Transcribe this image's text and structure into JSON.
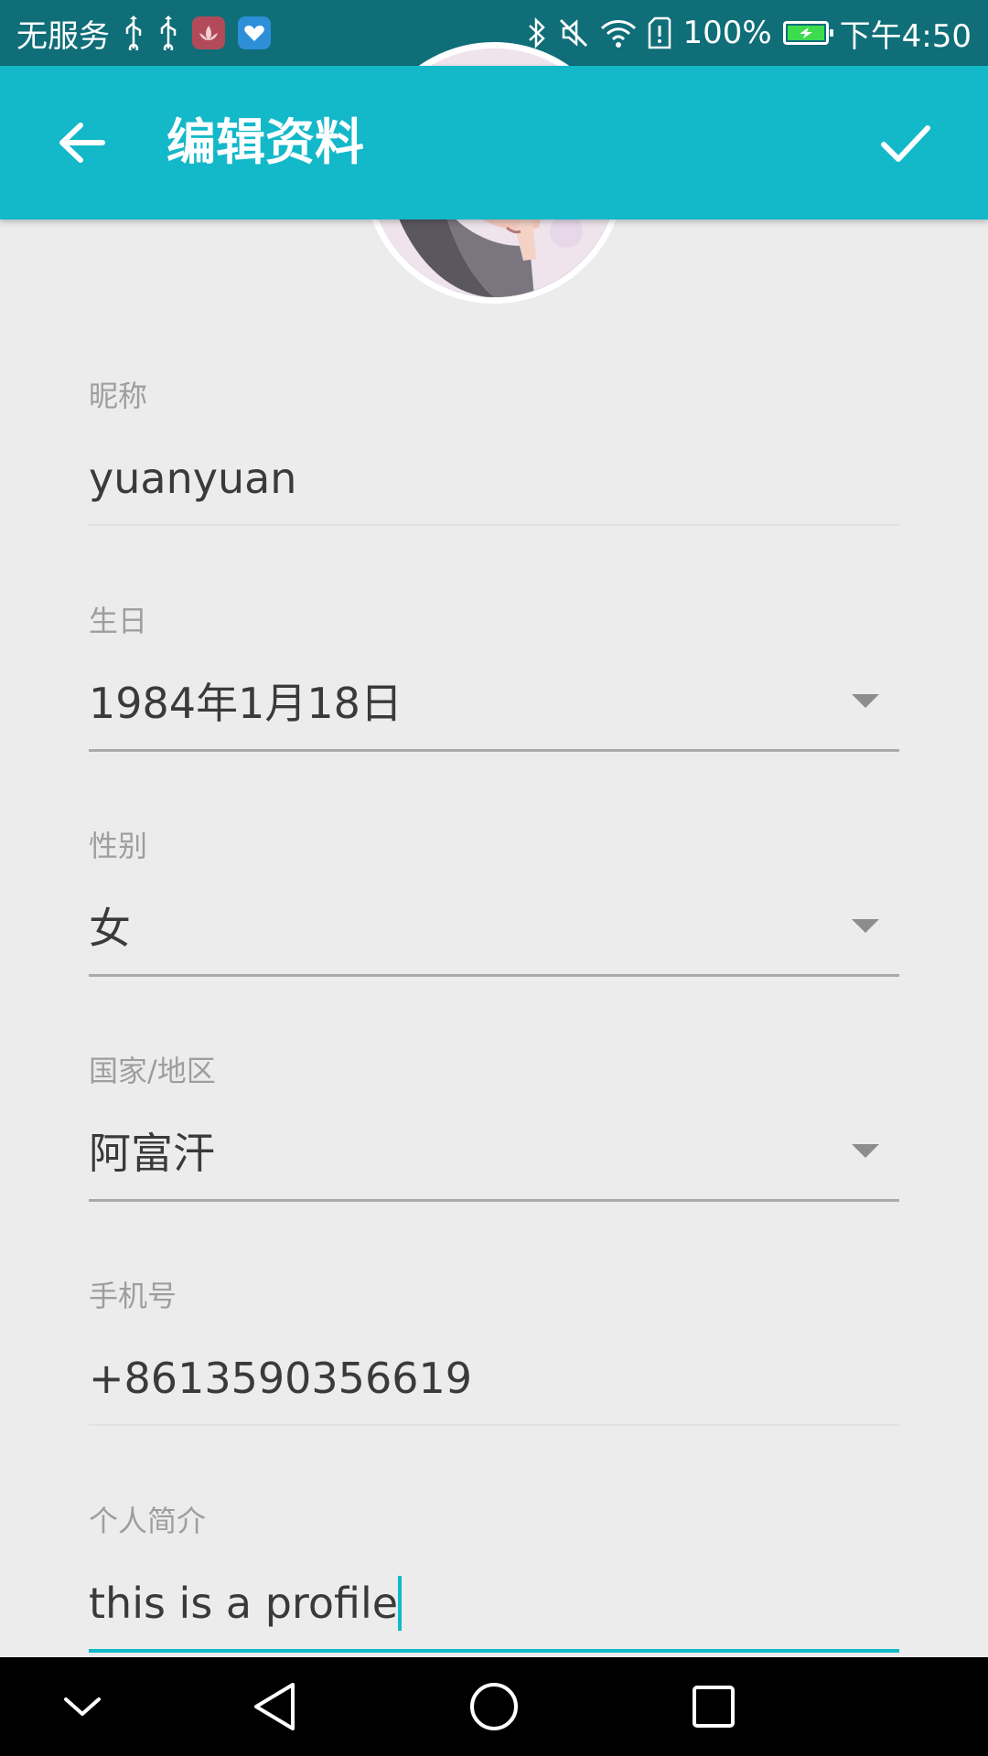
{
  "status_bar": {
    "carrier": "无服务",
    "battery": "100%",
    "time": "下午4:50",
    "battery_level_percent": 100,
    "icons": [
      "usb-icon",
      "usb-icon",
      "lotus-app-icon",
      "heart-app-icon",
      "bluetooth-icon",
      "mute-icon",
      "wifi-icon",
      "sim-alert-icon",
      "battery-charging-icon"
    ]
  },
  "app_bar": {
    "title": "编辑资料",
    "back_icon": "arrow-left-icon",
    "confirm_icon": "check-icon",
    "background_color": "#13b8c9"
  },
  "form": {
    "nickname": {
      "label": "昵称",
      "value": "yuanyuan"
    },
    "birthday": {
      "label": "生日",
      "value": "1984年1月18日"
    },
    "gender": {
      "label": "性别",
      "value": "女"
    },
    "country": {
      "label": "国家/地区",
      "value": "阿富汗"
    },
    "phone": {
      "label": "手机号",
      "value": "+8613590356619"
    },
    "bio": {
      "label": "个人简介",
      "value": "this is a profile"
    }
  },
  "colors": {
    "accent": "#13b8c9",
    "status_bar": "#0f6e78",
    "background": "#ececec"
  },
  "nav_bar": {
    "icons": [
      "chevron-down-icon",
      "back-triangle-icon",
      "home-circle-icon",
      "recents-square-icon"
    ]
  }
}
